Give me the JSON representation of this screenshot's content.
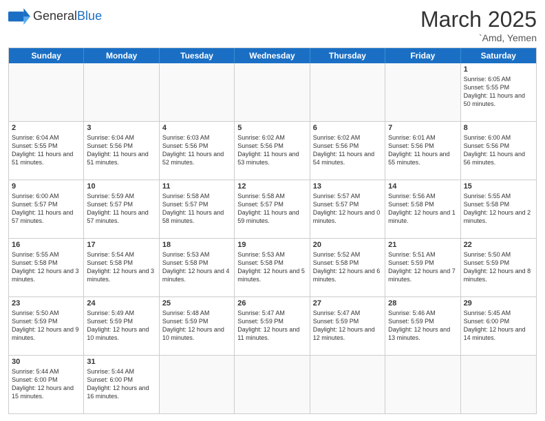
{
  "header": {
    "logo_general": "General",
    "logo_blue": "Blue",
    "month_title": "March 2025",
    "location": "`Amd, Yemen"
  },
  "days_of_week": [
    "Sunday",
    "Monday",
    "Tuesday",
    "Wednesday",
    "Thursday",
    "Friday",
    "Saturday"
  ],
  "weeks": [
    [
      {
        "day": "",
        "empty": true,
        "content": ""
      },
      {
        "day": "",
        "empty": true,
        "content": ""
      },
      {
        "day": "",
        "empty": true,
        "content": ""
      },
      {
        "day": "",
        "empty": true,
        "content": ""
      },
      {
        "day": "",
        "empty": true,
        "content": ""
      },
      {
        "day": "",
        "empty": true,
        "content": ""
      },
      {
        "day": "1",
        "empty": false,
        "content": "Sunrise: 6:05 AM\nSunset: 5:55 PM\nDaylight: 11 hours\nand 50 minutes."
      }
    ],
    [
      {
        "day": "2",
        "empty": false,
        "content": "Sunrise: 6:04 AM\nSunset: 5:55 PM\nDaylight: 11 hours\nand 51 minutes."
      },
      {
        "day": "3",
        "empty": false,
        "content": "Sunrise: 6:04 AM\nSunset: 5:56 PM\nDaylight: 11 hours\nand 51 minutes."
      },
      {
        "day": "4",
        "empty": false,
        "content": "Sunrise: 6:03 AM\nSunset: 5:56 PM\nDaylight: 11 hours\nand 52 minutes."
      },
      {
        "day": "5",
        "empty": false,
        "content": "Sunrise: 6:02 AM\nSunset: 5:56 PM\nDaylight: 11 hours\nand 53 minutes."
      },
      {
        "day": "6",
        "empty": false,
        "content": "Sunrise: 6:02 AM\nSunset: 5:56 PM\nDaylight: 11 hours\nand 54 minutes."
      },
      {
        "day": "7",
        "empty": false,
        "content": "Sunrise: 6:01 AM\nSunset: 5:56 PM\nDaylight: 11 hours\nand 55 minutes."
      },
      {
        "day": "8",
        "empty": false,
        "content": "Sunrise: 6:00 AM\nSunset: 5:56 PM\nDaylight: 11 hours\nand 56 minutes."
      }
    ],
    [
      {
        "day": "9",
        "empty": false,
        "content": "Sunrise: 6:00 AM\nSunset: 5:57 PM\nDaylight: 11 hours\nand 57 minutes."
      },
      {
        "day": "10",
        "empty": false,
        "content": "Sunrise: 5:59 AM\nSunset: 5:57 PM\nDaylight: 11 hours\nand 57 minutes."
      },
      {
        "day": "11",
        "empty": false,
        "content": "Sunrise: 5:58 AM\nSunset: 5:57 PM\nDaylight: 11 hours\nand 58 minutes."
      },
      {
        "day": "12",
        "empty": false,
        "content": "Sunrise: 5:58 AM\nSunset: 5:57 PM\nDaylight: 11 hours\nand 59 minutes."
      },
      {
        "day": "13",
        "empty": false,
        "content": "Sunrise: 5:57 AM\nSunset: 5:57 PM\nDaylight: 12 hours\nand 0 minutes."
      },
      {
        "day": "14",
        "empty": false,
        "content": "Sunrise: 5:56 AM\nSunset: 5:58 PM\nDaylight: 12 hours\nand 1 minute."
      },
      {
        "day": "15",
        "empty": false,
        "content": "Sunrise: 5:55 AM\nSunset: 5:58 PM\nDaylight: 12 hours\nand 2 minutes."
      }
    ],
    [
      {
        "day": "16",
        "empty": false,
        "content": "Sunrise: 5:55 AM\nSunset: 5:58 PM\nDaylight: 12 hours\nand 3 minutes."
      },
      {
        "day": "17",
        "empty": false,
        "content": "Sunrise: 5:54 AM\nSunset: 5:58 PM\nDaylight: 12 hours\nand 3 minutes."
      },
      {
        "day": "18",
        "empty": false,
        "content": "Sunrise: 5:53 AM\nSunset: 5:58 PM\nDaylight: 12 hours\nand 4 minutes."
      },
      {
        "day": "19",
        "empty": false,
        "content": "Sunrise: 5:53 AM\nSunset: 5:58 PM\nDaylight: 12 hours\nand 5 minutes."
      },
      {
        "day": "20",
        "empty": false,
        "content": "Sunrise: 5:52 AM\nSunset: 5:58 PM\nDaylight: 12 hours\nand 6 minutes."
      },
      {
        "day": "21",
        "empty": false,
        "content": "Sunrise: 5:51 AM\nSunset: 5:59 PM\nDaylight: 12 hours\nand 7 minutes."
      },
      {
        "day": "22",
        "empty": false,
        "content": "Sunrise: 5:50 AM\nSunset: 5:59 PM\nDaylight: 12 hours\nand 8 minutes."
      }
    ],
    [
      {
        "day": "23",
        "empty": false,
        "content": "Sunrise: 5:50 AM\nSunset: 5:59 PM\nDaylight: 12 hours\nand 9 minutes."
      },
      {
        "day": "24",
        "empty": false,
        "content": "Sunrise: 5:49 AM\nSunset: 5:59 PM\nDaylight: 12 hours\nand 10 minutes."
      },
      {
        "day": "25",
        "empty": false,
        "content": "Sunrise: 5:48 AM\nSunset: 5:59 PM\nDaylight: 12 hours\nand 10 minutes."
      },
      {
        "day": "26",
        "empty": false,
        "content": "Sunrise: 5:47 AM\nSunset: 5:59 PM\nDaylight: 12 hours\nand 11 minutes."
      },
      {
        "day": "27",
        "empty": false,
        "content": "Sunrise: 5:47 AM\nSunset: 5:59 PM\nDaylight: 12 hours\nand 12 minutes."
      },
      {
        "day": "28",
        "empty": false,
        "content": "Sunrise: 5:46 AM\nSunset: 5:59 PM\nDaylight: 12 hours\nand 13 minutes."
      },
      {
        "day": "29",
        "empty": false,
        "content": "Sunrise: 5:45 AM\nSunset: 6:00 PM\nDaylight: 12 hours\nand 14 minutes."
      }
    ],
    [
      {
        "day": "30",
        "empty": false,
        "content": "Sunrise: 5:44 AM\nSunset: 6:00 PM\nDaylight: 12 hours\nand 15 minutes."
      },
      {
        "day": "31",
        "empty": false,
        "content": "Sunrise: 5:44 AM\nSunset: 6:00 PM\nDaylight: 12 hours\nand 16 minutes."
      },
      {
        "day": "",
        "empty": true,
        "content": ""
      },
      {
        "day": "",
        "empty": true,
        "content": ""
      },
      {
        "day": "",
        "empty": true,
        "content": ""
      },
      {
        "day": "",
        "empty": true,
        "content": ""
      },
      {
        "day": "",
        "empty": true,
        "content": ""
      }
    ]
  ]
}
